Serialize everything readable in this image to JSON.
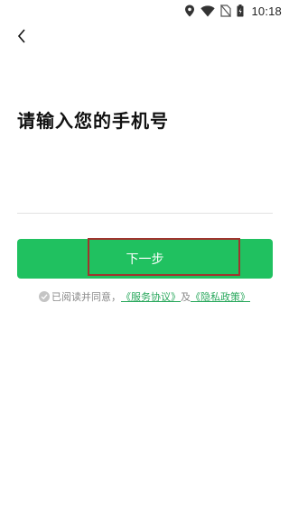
{
  "status_bar": {
    "time": "10:18",
    "icons": [
      "location-icon",
      "wifi-icon",
      "no-sim-icon",
      "battery-icon"
    ]
  },
  "nav": {
    "back_icon": "chevron-left-icon"
  },
  "page": {
    "title": "请输入您的手机号"
  },
  "phone_input": {
    "value": "",
    "placeholder": ""
  },
  "next_button": {
    "label": "下一步"
  },
  "agreement": {
    "prefix": "已阅读并同意，",
    "service_link": "《服务协议》",
    "connector": "及",
    "privacy_link": "《隐私政策》"
  },
  "colors": {
    "primary": "#20c160",
    "link": "#2aa85d",
    "highlight_border": "#a0342e",
    "muted_text": "#8a8a8a"
  }
}
